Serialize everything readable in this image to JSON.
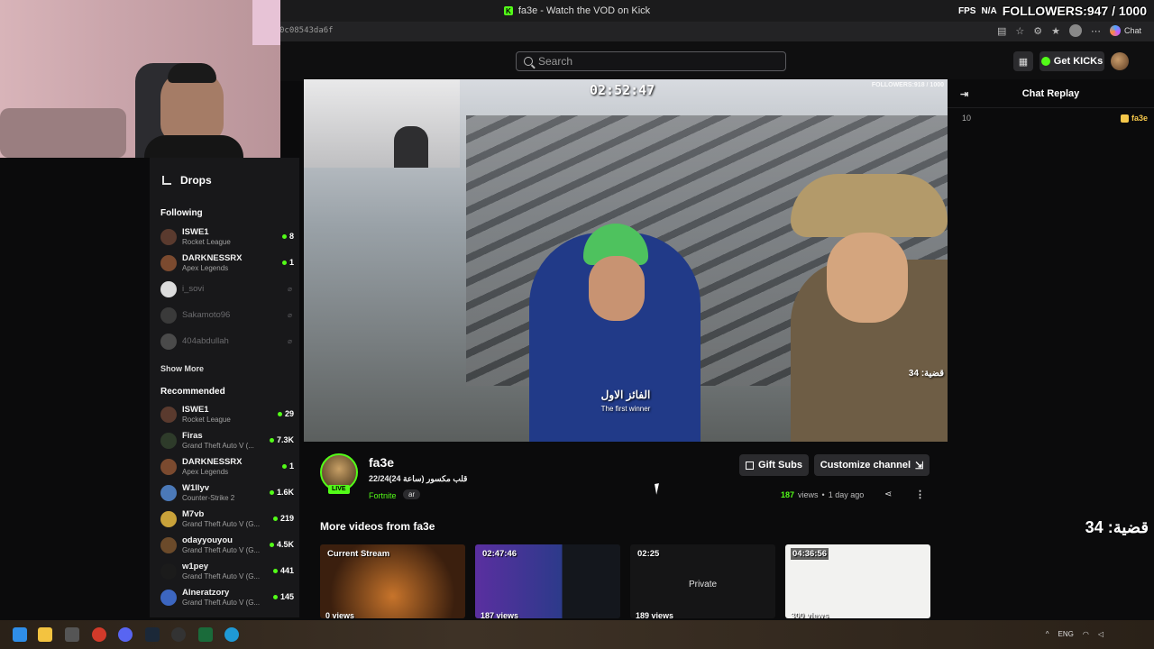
{
  "window": {
    "title": "fa3e - Watch the VOD on Kick",
    "url_fragment": "0c08543da6f"
  },
  "overlay": {
    "fps": "FPS",
    "fps_value": "N/A",
    "followers": "FOLLOWERS:947 / 1000"
  },
  "browser": {
    "copilot_label": "Chat"
  },
  "header": {
    "search_placeholder": "Search",
    "get_kicks": "Get KICKs"
  },
  "sidebar": {
    "drops": "Drops",
    "following_title": "Following",
    "following": [
      {
        "name": "ISWE1",
        "game": "Rocket League",
        "count": "8",
        "live": true,
        "color": "#5a3a2e"
      },
      {
        "name": "DARKNESSRX",
        "game": "Apex Legends",
        "count": "1",
        "live": true,
        "color": "#7b4a2f"
      },
      {
        "name": "i_sovi",
        "live": false,
        "color": "#dcdcdc"
      },
      {
        "name": "Sakamoto96",
        "live": false,
        "color": "#3a3a3a"
      },
      {
        "name": "404abdullah",
        "live": false,
        "color": "#4a4a4a"
      }
    ],
    "show_more": "Show More",
    "recommended_title": "Recommended",
    "recommended": [
      {
        "name": "ISWE1",
        "game": "Rocket League",
        "count": "29",
        "color": "#5a3a2e"
      },
      {
        "name": "Firas",
        "game": "Grand Theft Auto V (...",
        "count": "7.3K",
        "color": "#2e3b2a"
      },
      {
        "name": "DARKNESSRX",
        "game": "Apex Legends",
        "count": "1",
        "color": "#7b4a2f"
      },
      {
        "name": "W1llyv",
        "game": "Counter-Strike 2",
        "count": "1.6K",
        "color": "#4b79b8"
      },
      {
        "name": "M7vb",
        "game": "Grand Theft Auto V (G...",
        "count": "219",
        "color": "#c9a23a"
      },
      {
        "name": "odayyouyou",
        "game": "Grand Theft Auto V (G...",
        "count": "4.5K",
        "color": "#6b4a2a"
      },
      {
        "name": "w1pey",
        "game": "Grand Theft Auto V (G...",
        "count": "441",
        "color": "#1b1b1b"
      },
      {
        "name": "Alneratzory",
        "game": "Grand Theft Auto V (G...",
        "count": "145",
        "color": "#3c66c0"
      }
    ]
  },
  "video": {
    "timer": "02:52:47",
    "watermark": "FOLLOWERS:918 / 1000",
    "subtitle_ar": "الفائز الاول",
    "subtitle_en": "The first winner",
    "case_label": "قضية: 34"
  },
  "chat": {
    "title": "Chat Replay",
    "row_time": "10",
    "row_user": "fa3e",
    "overlay_case": "قضية: 34"
  },
  "channel": {
    "name": "fa3e",
    "live_badge": "LIVE",
    "stream_title": "22/24(24 ساعة) قلب مكسور",
    "category": "Fortnite",
    "tag": "ar",
    "gift_subs": "Gift Subs",
    "customize": "Customize channel",
    "views_count": "187",
    "views_label": "views",
    "separator": "•",
    "ago": "1 day ago"
  },
  "more_videos": {
    "title": "More videos from fa3e",
    "items": [
      {
        "label": "Current Stream",
        "views": "0 views"
      },
      {
        "label": "02:47:46",
        "views": "187 views"
      },
      {
        "label": "02:25",
        "views": "189 views",
        "private": "Private"
      },
      {
        "label": "04:36:56",
        "views": "300 views"
      }
    ]
  },
  "taskbar": {
    "lang": "ENG"
  }
}
